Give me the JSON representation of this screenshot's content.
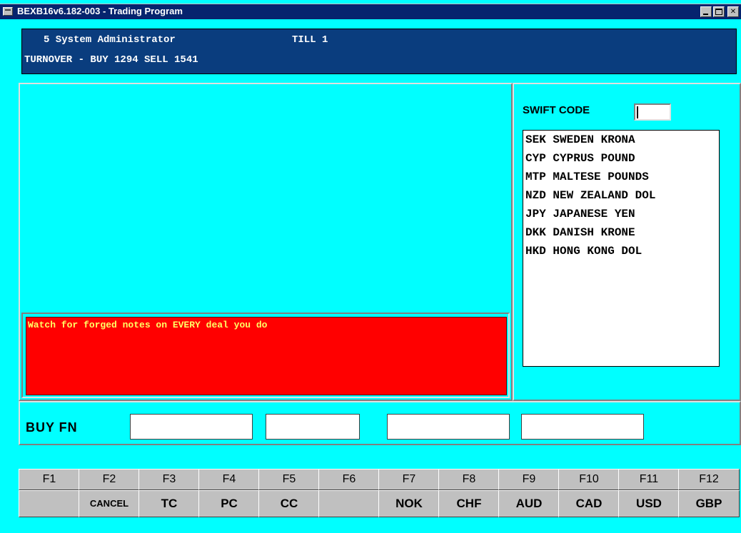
{
  "window": {
    "title": "BEXB16v6.182-003 - Trading Program",
    "controls": {
      "minimize": "",
      "maximize": "",
      "close": "✕"
    }
  },
  "header": {
    "user": "5 System Administrator",
    "till": "TILL 1",
    "turnover": "TURNOVER - BUY 1294 SELL 1541"
  },
  "warning": "Watch for forged notes on EVERY deal you do",
  "swift": {
    "label": "SWIFT CODE",
    "value": ""
  },
  "currencies": [
    "SEK SWEDEN KRONA",
    "CYP CYPRUS POUND",
    "MTP MALTESE POUNDS",
    "NZD NEW ZEALAND DOL",
    "JPY JAPANESE YEN",
    "DKK DANISH KRONE",
    "HKD HONG KONG DOL"
  ],
  "buy": {
    "label": "BUY FN",
    "fields": [
      "",
      "",
      "",
      ""
    ]
  },
  "function_keys": [
    {
      "key": "F1",
      "label": ""
    },
    {
      "key": "F2",
      "label": "CANCEL"
    },
    {
      "key": "F3",
      "label": "TC"
    },
    {
      "key": "F4",
      "label": "PC"
    },
    {
      "key": "F5",
      "label": "CC"
    },
    {
      "key": "F6",
      "label": ""
    },
    {
      "key": "F7",
      "label": "NOK"
    },
    {
      "key": "F8",
      "label": "CHF"
    },
    {
      "key": "F9",
      "label": "AUD"
    },
    {
      "key": "F10",
      "label": "CAD"
    },
    {
      "key": "F11",
      "label": "USD"
    },
    {
      "key": "F12",
      "label": "GBP"
    }
  ],
  "colors": {
    "background": "#00ffff",
    "header": "#0a3d7e",
    "warning_bg": "#ff0000",
    "warning_text": "#ffff66",
    "title_bar": "#06246e"
  }
}
